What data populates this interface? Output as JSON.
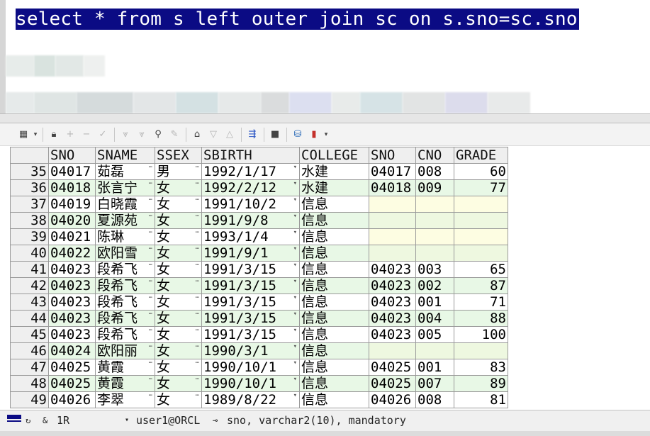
{
  "editor": {
    "sql": "select * from s left outer join sc on s.sno=sc.sno"
  },
  "grid": {
    "columns": [
      "SNO",
      "SNAME",
      "SSEX",
      "SBIRTH",
      "COLLEGE",
      "SNO",
      "CNO",
      "GRADE"
    ],
    "rows": [
      {
        "n": "35",
        "sno": "04017",
        "sname": "茹磊",
        "ssex": "男",
        "sbirth": "1992/1/17",
        "college": "水建",
        "sno2": "04017",
        "cno": "008",
        "grade": "60"
      },
      {
        "n": "36",
        "sno": "04018",
        "sname": "张言宁",
        "ssex": "女",
        "sbirth": "1992/2/12",
        "college": "水建",
        "sno2": "04018",
        "cno": "009",
        "grade": "77"
      },
      {
        "n": "37",
        "sno": "04019",
        "sname": "白晓霞",
        "ssex": "女",
        "sbirth": "1991/10/2",
        "college": "信息",
        "sno2": "",
        "cno": "",
        "grade": ""
      },
      {
        "n": "38",
        "sno": "04020",
        "sname": "夏源苑",
        "ssex": "女",
        "sbirth": "1991/9/8",
        "college": "信息",
        "sno2": "",
        "cno": "",
        "grade": ""
      },
      {
        "n": "39",
        "sno": "04021",
        "sname": "陈琳",
        "ssex": "女",
        "sbirth": "1993/1/4",
        "college": "信息",
        "sno2": "",
        "cno": "",
        "grade": ""
      },
      {
        "n": "40",
        "sno": "04022",
        "sname": "欧阳雪",
        "ssex": "女",
        "sbirth": "1991/9/1",
        "college": "信息",
        "sno2": "",
        "cno": "",
        "grade": ""
      },
      {
        "n": "41",
        "sno": "04023",
        "sname": "段希飞",
        "ssex": "女",
        "sbirth": "1991/3/15",
        "college": "信息",
        "sno2": "04023",
        "cno": "003",
        "grade": "65"
      },
      {
        "n": "42",
        "sno": "04023",
        "sname": "段希飞",
        "ssex": "女",
        "sbirth": "1991/3/15",
        "college": "信息",
        "sno2": "04023",
        "cno": "002",
        "grade": "87"
      },
      {
        "n": "43",
        "sno": "04023",
        "sname": "段希飞",
        "ssex": "女",
        "sbirth": "1991/3/15",
        "college": "信息",
        "sno2": "04023",
        "cno": "001",
        "grade": "71"
      },
      {
        "n": "44",
        "sno": "04023",
        "sname": "段希飞",
        "ssex": "女",
        "sbirth": "1991/3/15",
        "college": "信息",
        "sno2": "04023",
        "cno": "004",
        "grade": "88"
      },
      {
        "n": "45",
        "sno": "04023",
        "sname": "段希飞",
        "ssex": "女",
        "sbirth": "1991/3/15",
        "college": "信息",
        "sno2": "04023",
        "cno": "005",
        "grade": "100"
      },
      {
        "n": "46",
        "sno": "04024",
        "sname": "欧阳丽",
        "ssex": "女",
        "sbirth": "1990/3/1",
        "college": "信息",
        "sno2": "",
        "cno": "",
        "grade": ""
      },
      {
        "n": "47",
        "sno": "04025",
        "sname": "黄霞",
        "ssex": "女",
        "sbirth": "1990/10/1",
        "college": "信息",
        "sno2": "04025",
        "cno": "001",
        "grade": "83"
      },
      {
        "n": "48",
        "sno": "04025",
        "sname": "黄霞",
        "ssex": "女",
        "sbirth": "1990/10/1",
        "college": "信息",
        "sno2": "04025",
        "cno": "007",
        "grade": "89"
      },
      {
        "n": "49",
        "sno": "04026",
        "sname": "李翠",
        "ssex": "女",
        "sbirth": "1989/8/22",
        "college": "信息",
        "sno2": "04026",
        "cno": "008",
        "grade": "81"
      }
    ]
  },
  "statusbar": {
    "records": "1R",
    "connection": "user1@ORCL",
    "field_info": "sno, varchar2(10), mandatory"
  },
  "colors": {
    "sql_highlight": "#0b0b84",
    "row_alt": "#e8f8e6",
    "null_cell": "#fdfde2"
  },
  "toolbar_icons": [
    "grid-layout-icon",
    "dropdown-arrow-icon",
    "lock-icon",
    "add-record-icon",
    "delete-record-icon",
    "post-changes-icon",
    "next-page-icon",
    "last-page-icon",
    "find-icon",
    "clear-icon",
    "query-by-example-icon",
    "filter-icon",
    "sort-icon",
    "link-icon",
    "save-icon",
    "export-icon",
    "chart-icon"
  ]
}
